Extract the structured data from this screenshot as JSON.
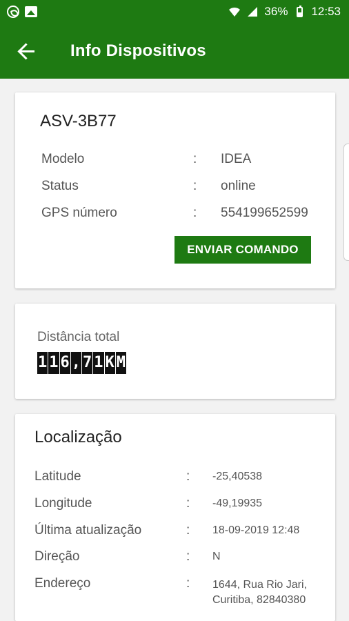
{
  "status_bar": {
    "battery": "36%",
    "time": "12:53",
    "icons": [
      "whatsapp-icon",
      "image-icon",
      "wifi-icon",
      "signal-icon",
      "battery-icon"
    ]
  },
  "app_bar": {
    "title": "Info Dispositivos",
    "back_icon": "arrow-left-icon"
  },
  "device": {
    "plate": "ASV-3B77",
    "rows": [
      {
        "label": "Modelo",
        "sep": ":",
        "value": "IDEA"
      },
      {
        "label": "Status",
        "sep": ":",
        "value": "online"
      },
      {
        "label": "GPS número",
        "sep": ":",
        "value": "554199652599"
      }
    ],
    "button_label": "ENVIAR COMANDO"
  },
  "distance": {
    "label": "Distância total",
    "chars": [
      "1",
      "1",
      "6",
      ",",
      "7",
      "1",
      "K",
      "M"
    ]
  },
  "location": {
    "title": "Localização",
    "rows": [
      {
        "label": "Latitude",
        "sep": ":",
        "value": "-25,40538"
      },
      {
        "label": "Longitude",
        "sep": ":",
        "value": "-49,19935"
      },
      {
        "label": "Última atualização",
        "sep": ":",
        "value": "18-09-2019 12:48"
      },
      {
        "label": "Direção",
        "sep": ":",
        "value": "N"
      },
      {
        "label": "Endereço",
        "sep": ":",
        "value": "1644, Rua Rio Jari, Curitiba, 82840380"
      }
    ]
  },
  "colors": {
    "primary": "#1e7a12",
    "background": "#f2f2f2"
  }
}
